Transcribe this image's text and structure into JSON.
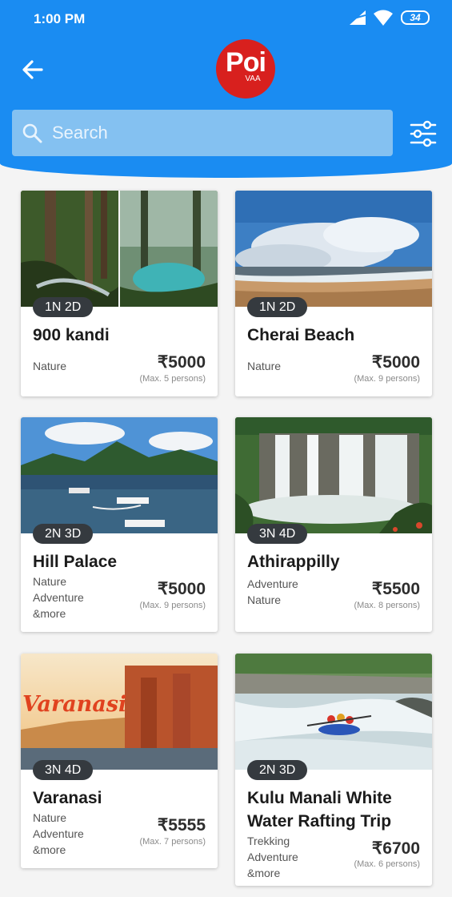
{
  "status_bar": {
    "time": "1:00 PM",
    "battery": "34"
  },
  "header": {
    "logo_main": "Poi",
    "logo_sub": "VAA"
  },
  "search": {
    "placeholder": "Search"
  },
  "colors": {
    "header_blue": "#1a8cf2",
    "search_bg": "#84c1f1",
    "logo_red": "#d8201e",
    "badge_bg": "#353a3f"
  },
  "icons": {
    "back": "arrow-left-icon",
    "search": "search-icon",
    "filter": "sliders-icon",
    "signal": "signal-icon",
    "wifi": "wifi-icon",
    "battery": "battery-icon"
  },
  "packages": [
    {
      "duration": "1N 2D",
      "title": "900 kandi",
      "tags": [
        "Nature"
      ],
      "price": "₹5000",
      "max": "(Max. 5 persons)"
    },
    {
      "duration": "1N 2D",
      "title": "Cherai Beach",
      "tags": [
        "Nature"
      ],
      "price": "₹5000",
      "max": "(Max. 9 persons)"
    },
    {
      "duration": "2N 3D",
      "title": "Hill Palace",
      "tags": [
        "Nature",
        "Adventure",
        "&more"
      ],
      "price": "₹5000",
      "max": "(Max. 9 persons)"
    },
    {
      "duration": "3N 4D",
      "title": "Athirappilly",
      "tags": [
        "Adventure",
        "Nature"
      ],
      "price": "₹5500",
      "max": "(Max. 8 persons)"
    },
    {
      "duration": "3N 4D",
      "title": "Varanasi",
      "image_text": "Varanasi",
      "tags": [
        "Nature",
        "Adventure",
        "&more"
      ],
      "price": "₹5555",
      "max": "(Max. 7 persons)"
    },
    {
      "duration": "2N 3D",
      "title": "Kulu Manali White Water Rafting Trip",
      "tags": [
        "Trekking",
        "Adventure",
        "&more"
      ],
      "price": "₹6700",
      "max": "(Max. 6 persons)"
    }
  ]
}
